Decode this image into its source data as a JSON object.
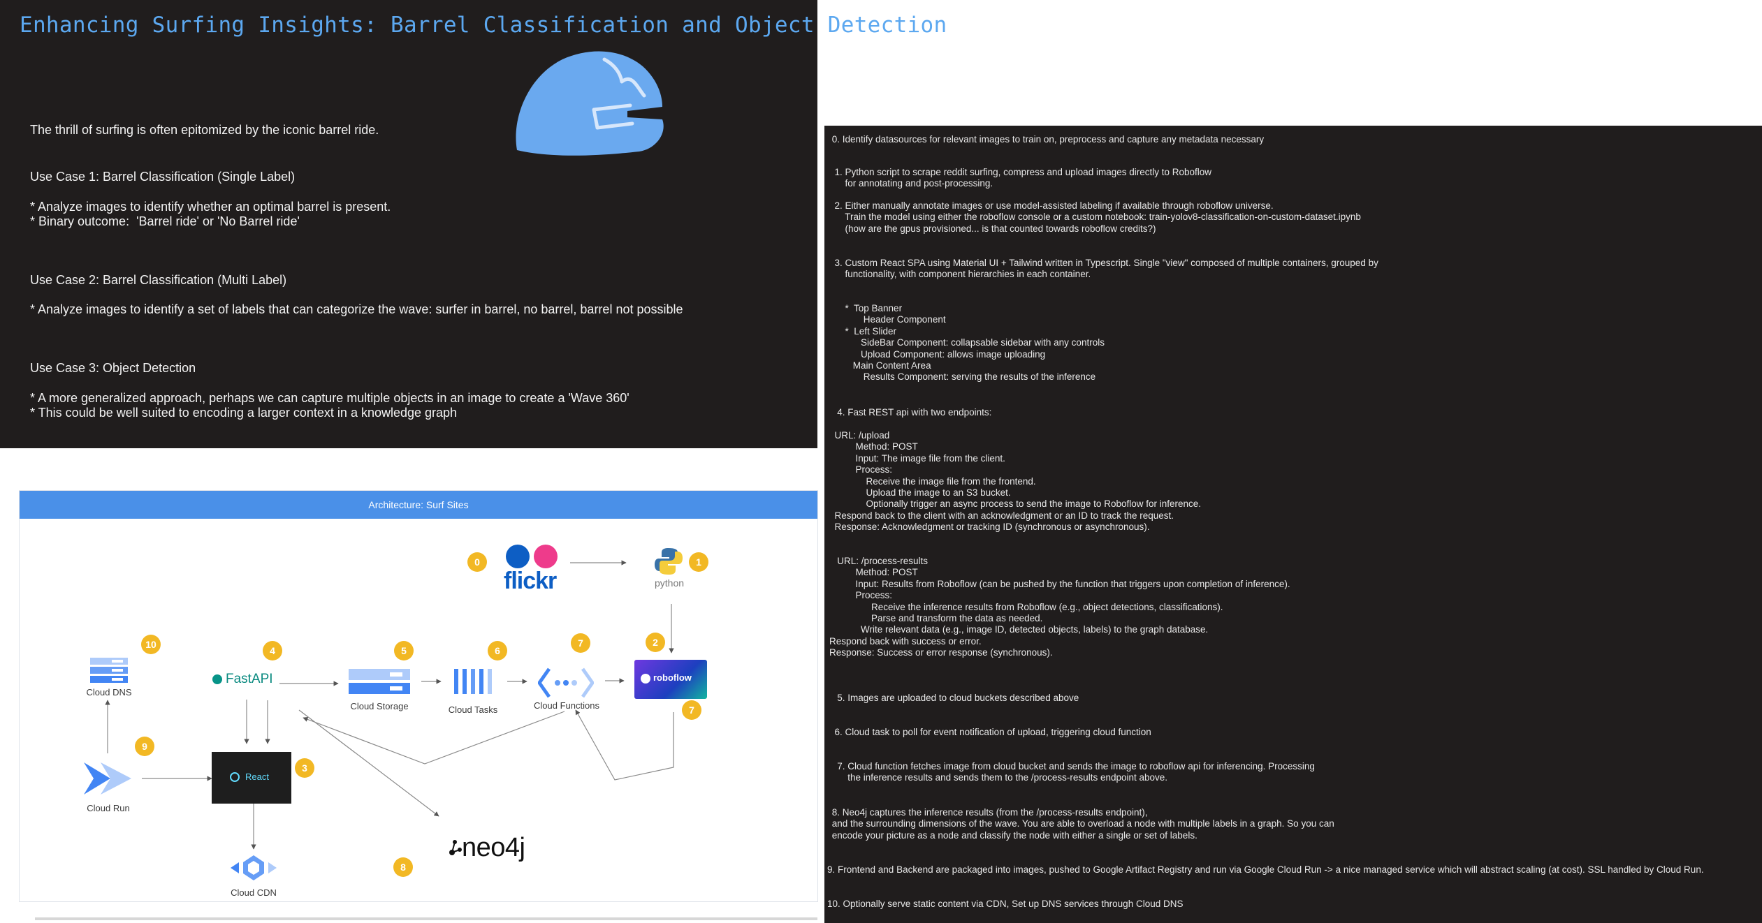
{
  "intro": {
    "title": "Enhancing Surfing Insights: Barrel Classification and Object Detection",
    "lines": [
      "The thrill of surfing is often epitomized by the iconic barrel ride.",
      "Use Case 1: Barrel Classification (Single Label)",
      "* Analyze images to identify whether an optimal barrel is present.",
      "* Binary outcome:  'Barrel ride' or 'No Barrel ride'",
      "Use Case 2: Barrel Classification (Multi Label)",
      "* Analyze images to identify a set of labels that can categorize the wave: surfer in barrel, no barrel, barrel not possible",
      "Use Case 3: Object Detection",
      "* A more generalized approach, perhaps we can capture multiple objects in an image to create a 'Wave 360'",
      "* This could be well suited to encoding a larger context in a knowledge graph"
    ]
  },
  "architecture": {
    "header": "Architecture: Surf Sites",
    "nodes": {
      "flickr": "flickr",
      "python": "python",
      "roboflow": "roboflow",
      "fastapi": "FastAPI",
      "storage": "Cloud Storage",
      "tasks": "Cloud Tasks",
      "functions": "Cloud Functions",
      "dns": "Cloud DNS",
      "run": "Cloud Run",
      "react": "React",
      "cdn": "Cloud CDN",
      "neo4j": "neo4j"
    },
    "badges": [
      "0",
      "1",
      "2",
      "3",
      "4",
      "5",
      "6",
      "7",
      "7",
      "8",
      "9",
      "10"
    ]
  },
  "steps": [
    " 0. Identify datasources for relevant images to train on, preprocess and capture any metadata necessary",
    "  1. Python script to scrape reddit surfing, compress and upload images directly to Roboflow\n      for annotating and post-processing.",
    "  2. Either manually annotate images or use model-assisted labeling if available through roboflow universe.\n      Train the model using either the roboflow console or a custom notebook: train-yolov8-classification-on-custom-dataset.ipynb\n      (how are the gpus provisioned... is that counted towards roboflow credits?)",
    "  3. Custom React SPA using Material UI + Tailwind written in Typescript. Single \"view\" composed of multiple containers, grouped by\n      functionality, with component hierarchies in each container.",
    "      *  Top Banner\n             Header Component\n      *  Left Slider\n            SideBar Component: collapsable sidebar with any controls\n            Upload Component: allows image uploading\n         Main Content Area\n             Results Component: serving the results of the inference",
    "   4. Fast REST api with two endpoints:",
    "  URL: /upload\n          Method: POST\n          Input: The image file from the client.\n          Process:\n              Receive the image file from the frontend.\n              Upload the image to an S3 bucket.\n              Optionally trigger an async process to send the image to Roboflow for inference.\n  Respond back to the client with an acknowledgment or an ID to track the request.\n  Response: Acknowledgment or tracking ID (synchronous or asynchronous).",
    "   URL: /process-results\n          Method: POST\n          Input: Results from Roboflow (can be pushed by the function that triggers upon completion of inference).\n          Process:\n                Receive the inference results from Roboflow (e.g., object detections, classifications).\n                Parse and transform the data as needed.\n            Write relevant data (e.g., image ID, detected objects, labels) to the graph database.\nRespond back with success or error.\nResponse: Success or error response (synchronous).",
    "   5. Images are uploaded to cloud buckets described above",
    "  6. Cloud task to poll for event notification of upload, triggering cloud function",
    "   7. Cloud function fetches image from cloud bucket and sends the image to roboflow api for inferencing. Processing\n       the inference results and sends them to the /process-results endpoint above.",
    " 8. Neo4j captures the inference results (from the /process-results endpoint),\n and the surrounding dimensions of the wave. You are able to overload a node with multiple labels in a graph. So you can\n encode your picture as a node and classify the node with either a single or set of labels.",
    "9. Frontend and Backend are packaged into images, pushed to Google Artifact Registry and run via Google Cloud Run -> a nice managed service which will abstract scaling (at cost). SSL handled by Cloud Run.",
    "10. Optionally serve static content via CDN, Set up DNS services through Cloud DNS"
  ],
  "colors": {
    "panel": "#201d1d",
    "title": "#5ca8f0",
    "header": "#4a90e8",
    "badge": "#f2b824",
    "helmet": "#6aa9ef"
  }
}
